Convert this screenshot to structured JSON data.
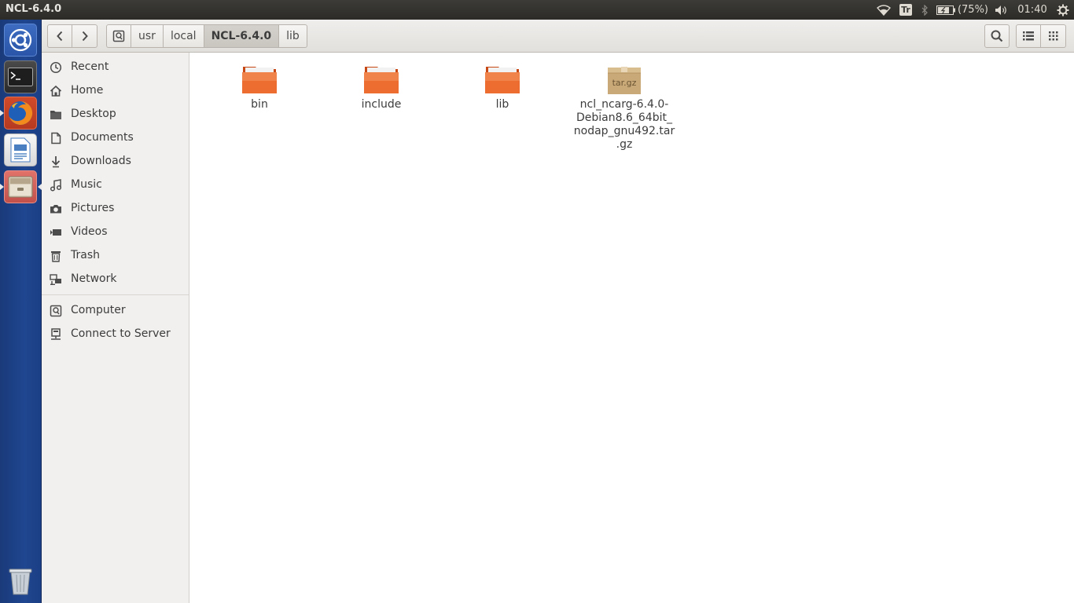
{
  "window": {
    "title": "NCL-6.4.0"
  },
  "indicators": {
    "keyboard": "Tr",
    "battery": "(75%)",
    "clock": "01:40"
  },
  "launcher": {
    "items": [
      {
        "name": "Ubuntu Dash"
      },
      {
        "name": "Terminal"
      },
      {
        "name": "Firefox"
      },
      {
        "name": "LibreOffice Writer"
      },
      {
        "name": "Files"
      },
      {
        "name": "Trash"
      }
    ]
  },
  "pathbar": {
    "segments": [
      "usr",
      "local",
      "NCL-6.4.0",
      "lib"
    ],
    "active_index": 2
  },
  "sidebar": {
    "places": [
      {
        "label": "Recent",
        "icon": "clock-icon"
      },
      {
        "label": "Home",
        "icon": "home-icon"
      },
      {
        "label": "Desktop",
        "icon": "folder-icon"
      },
      {
        "label": "Documents",
        "icon": "document-icon"
      },
      {
        "label": "Downloads",
        "icon": "download-icon"
      },
      {
        "label": "Music",
        "icon": "music-icon"
      },
      {
        "label": "Pictures",
        "icon": "camera-icon"
      },
      {
        "label": "Videos",
        "icon": "video-icon"
      },
      {
        "label": "Trash",
        "icon": "trash-icon"
      },
      {
        "label": "Network",
        "icon": "network-icon"
      }
    ],
    "devices": [
      {
        "label": "Computer",
        "icon": "drive-icon"
      },
      {
        "label": "Connect to Server",
        "icon": "server-icon"
      }
    ]
  },
  "files": [
    {
      "name": "bin",
      "type": "folder"
    },
    {
      "name": "include",
      "type": "folder"
    },
    {
      "name": "lib",
      "type": "folder"
    },
    {
      "name": "ncl_ncarg-6.4.0-Debian8.6_64bit_nodap_gnu492.tar.gz",
      "type": "archive",
      "icon_label": "tar.gz"
    }
  ],
  "colors": {
    "accent": "#e95420",
    "launcher": "#1f4690",
    "panel": "#3c3b37"
  }
}
